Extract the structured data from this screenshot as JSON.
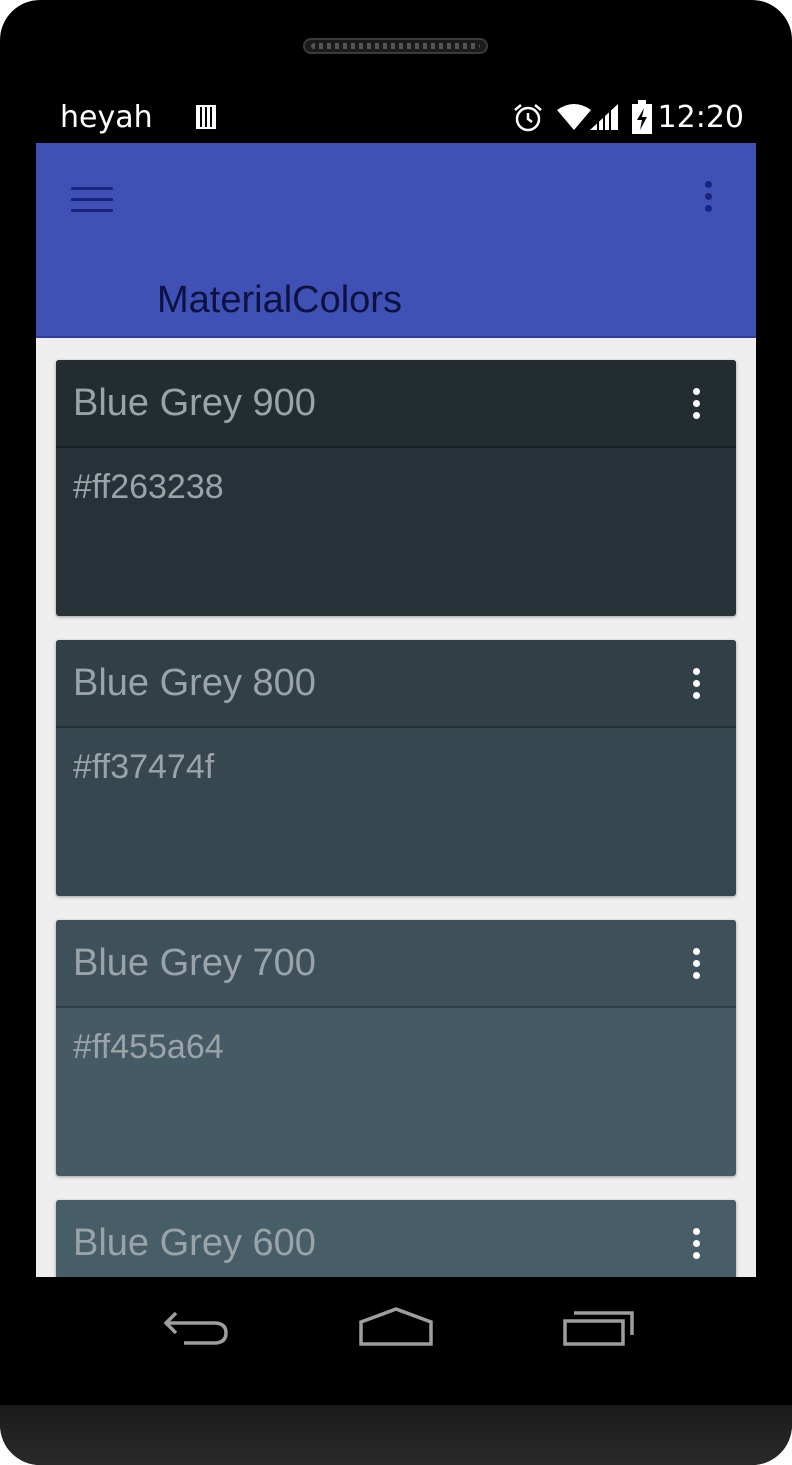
{
  "status_bar": {
    "carrier": "heyah",
    "time": "12:20",
    "icons": [
      "sim-icon",
      "alarm-icon",
      "wifi-icon",
      "signal-icon",
      "battery-charging-icon"
    ]
  },
  "app_bar": {
    "title": "MaterialColors",
    "color": "#3f51b5",
    "icons": [
      "menu-icon",
      "overflow-menu-icon"
    ]
  },
  "cards": [
    {
      "name": "Blue Grey 900",
      "hex": "#ff263238",
      "header_color": "#222c31",
      "body_color": "#263238"
    },
    {
      "name": "Blue Grey 800",
      "hex": "#ff37474f",
      "header_color": "#313f46",
      "body_color": "#37474f"
    },
    {
      "name": "Blue Grey 700",
      "hex": "#ff455a64",
      "header_color": "#3e515a",
      "body_color": "#455a64"
    },
    {
      "name": "Blue Grey 600",
      "hex": "",
      "header_color": "#475d67",
      "body_color": "#546e7a"
    }
  ],
  "nav_bar": {
    "icons": [
      "back-icon",
      "home-icon",
      "recents-icon"
    ]
  }
}
